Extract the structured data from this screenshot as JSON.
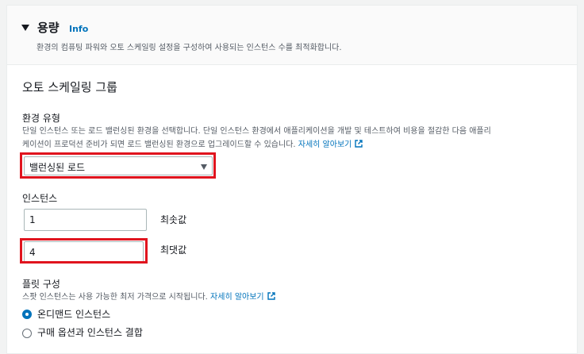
{
  "section": {
    "title": "용량",
    "info_link": "Info",
    "description": "환경의 컴퓨팅 파워와 오토 스케일링 설정을 구성하여 사용되는 인스턴스 수를 최적화합니다."
  },
  "autoscaling": {
    "title": "오토 스케일링 그룹",
    "env_type": {
      "label": "환경 유형",
      "hint_line1": "단일 인스턴스 또는 로드 밸런싱된 환경을 선택합니다. 단일 인스턴스 환경에서 애플리케이션을 개발 및 테스트하여 비용을 절감한 다음 애플리",
      "hint_line2": "케이션이 프로덕션 준비가 되면 로드 밸런싱된 환경으로 업그레이드할 수 있습니다.",
      "learn_more": "자세히 알아보기",
      "selected": "밸런싱된 로드"
    },
    "instances": {
      "label": "인스턴스",
      "min_value": "1",
      "min_caption": "최솟값",
      "max_value": "4",
      "max_caption": "최댓값"
    },
    "fleet": {
      "label": "플릿 구성",
      "hint": "스팟 인스턴스는 사용 가능한 최저 가격으로 시작됩니다.",
      "learn_more": "자세히 알아보기",
      "options": [
        {
          "label": "온디맨드 인스턴스",
          "checked": true
        },
        {
          "label": "구매 옵션과 인스턴스 결합",
          "checked": false
        }
      ]
    }
  },
  "colors": {
    "link": "#0073bb",
    "highlight": "#e0141e"
  }
}
